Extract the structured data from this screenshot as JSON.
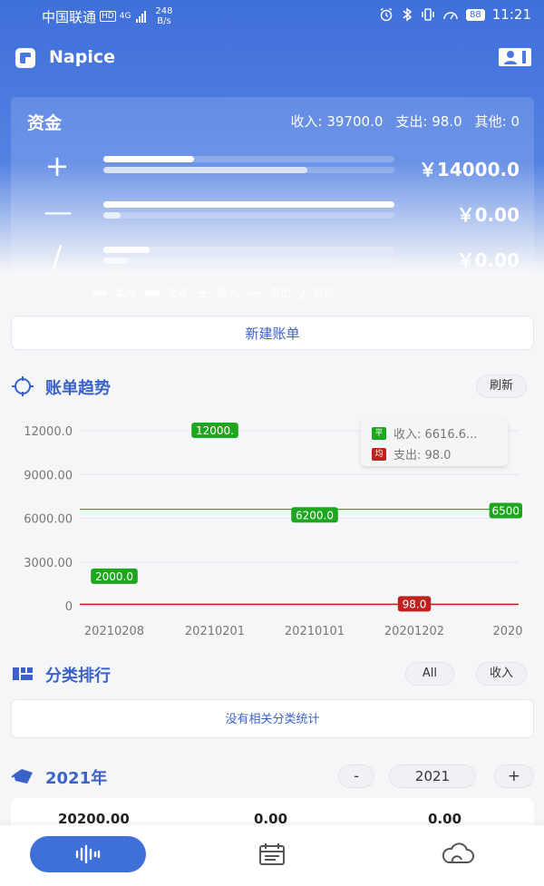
{
  "status": {
    "carrier": "中国联通",
    "hd": "HD",
    "network": "4G",
    "speed_value": "248",
    "speed_unit": "B/s",
    "battery": "88",
    "time": "11:21"
  },
  "header": {
    "app_name": "Napice"
  },
  "funds": {
    "title": "资金",
    "income_label": "收入: 39700.0",
    "expense_label": "支出: 98.0",
    "other_label": "其他: 0",
    "rows": [
      {
        "symbol": "+",
        "amount": "￥14000.0",
        "month_pct": 0.31,
        "year_pct": 0.7
      },
      {
        "symbol": "—",
        "amount": "￥0.00",
        "month_pct": 1.0,
        "year_pct": 0.06
      },
      {
        "symbol": "/",
        "amount": "￥0.00",
        "month_pct": 0.16,
        "year_pct": 0.08
      }
    ],
    "legend": {
      "month": "本月",
      "year": "全年",
      "income_sym": "+",
      "income": "收入",
      "expense_sym": "—",
      "expense": "支出",
      "other_sym": "/",
      "other": "其他"
    }
  },
  "new_bill_button": "新建账单",
  "trend": {
    "title": "账单趋势",
    "refresh": "刷新",
    "tooltip": {
      "income_tag": "平",
      "income_text": "收入: 6616.6...",
      "expense_tag": "均",
      "expense_text": "支出: 98.0"
    }
  },
  "chart_data": {
    "type": "line",
    "categories": [
      "20210208",
      "20210201",
      "20210101",
      "20201202",
      "2020"
    ],
    "y_ticks": [
      "12000.0",
      "9000.00",
      "6000.00",
      "3000.00",
      "0"
    ],
    "ylim": [
      0,
      12000
    ],
    "grid": true,
    "series": [
      {
        "name": "收入",
        "color": "#1fa61f",
        "values": [
          2000,
          12000,
          6200,
          6200,
          6500
        ],
        "labels": [
          "2000.0",
          "12000.",
          "6200.0",
          "",
          "6500"
        ]
      },
      {
        "name": "支出",
        "color": "#c0201e",
        "values": [
          0,
          0,
          0,
          98,
          0
        ],
        "labels": [
          "",
          "",
          "",
          "98.0",
          ""
        ]
      }
    ],
    "avg_income": 6616.6,
    "avg_expense": 98.0
  },
  "category": {
    "title": "分类排行",
    "filter_all": "All",
    "filter_income": "收入",
    "empty_text": "没有相关分类统计"
  },
  "year": {
    "title": "2021年",
    "minus": "-",
    "value": "2021",
    "plus": "+",
    "col1": "20200.00",
    "col2": "0.00",
    "col3": "0.00"
  },
  "colors": {
    "primary": "#3f6fd9",
    "income": "#1fa61f",
    "expense": "#c0201e"
  }
}
